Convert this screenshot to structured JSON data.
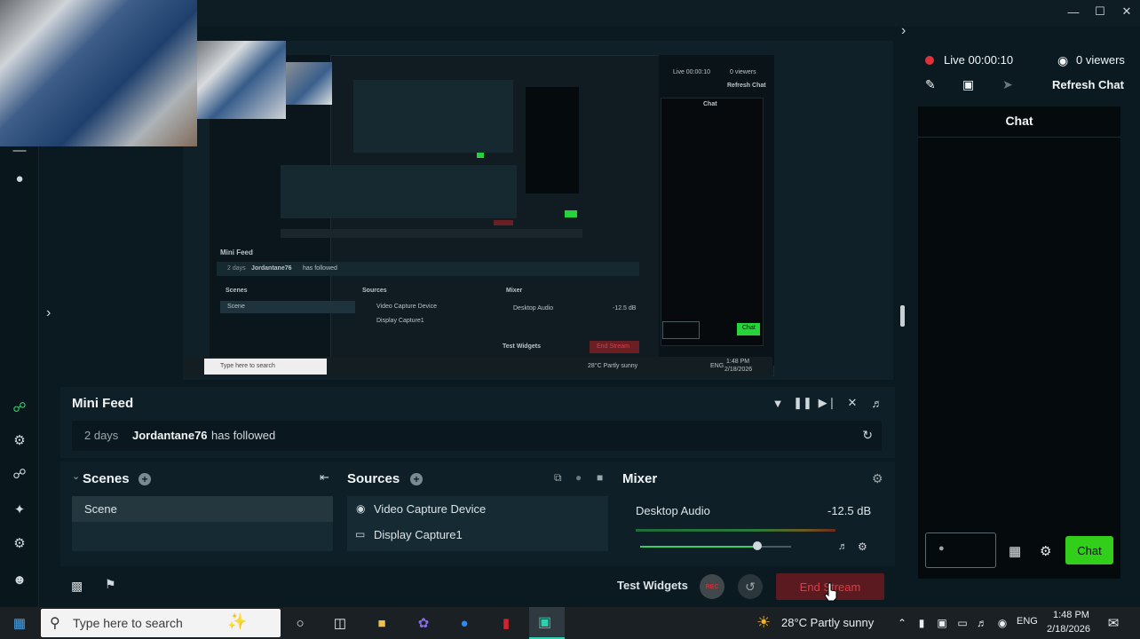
{
  "window": {
    "minimize_icon": "minimize-icon",
    "maximize_icon": "maximize-icon",
    "close_icon": "close-icon"
  },
  "mini_feed": {
    "title": "Mini Feed",
    "events": [
      {
        "time": "2 days",
        "user": "Jordantane76",
        "action": "has followed"
      }
    ]
  },
  "scenes": {
    "title": "Scenes",
    "items": [
      "Scene"
    ]
  },
  "sources": {
    "title": "Sources",
    "items": [
      "Video Capture Device",
      "Display Capture1"
    ]
  },
  "mixer": {
    "title": "Mixer",
    "channels": [
      {
        "name": "Desktop Audio",
        "level": "-12.5 dB",
        "volume_fraction": 0.78
      }
    ]
  },
  "controls": {
    "test_widgets": "Test Widgets",
    "rec_label": "REC",
    "end_stream": "End Stream"
  },
  "stream_status": {
    "live": "Live 00:00:10",
    "viewers": "0 viewers",
    "refresh_chat": "Refresh Chat"
  },
  "chat": {
    "title": "Chat",
    "send_label": "Chat"
  },
  "nested_preview": {
    "live": "Live 00:00:10",
    "viewers": "0 viewers",
    "refresh_chat": "Refresh Chat",
    "chat_title": "Chat",
    "mini_feed_title": "Mini Feed",
    "feed_time": "2 days",
    "feed_user": "Jordantane76",
    "feed_action": "has followed",
    "scenes": "Scenes",
    "scene_item": "Scene",
    "sources": "Sources",
    "source_1": "Video Capture Device",
    "source_2": "Display Capture1",
    "mixer": "Mixer",
    "desktop_audio": "Desktop Audio",
    "audio_level": "-12.5 dB",
    "test_widgets": "Test Widgets",
    "end_stream": "End Stream",
    "chat_button": "Chat",
    "search_placeholder": "Type here to search",
    "weather": "28°C  Partly sunny",
    "lang": "ENG",
    "time": "1:48 PM",
    "date": "2/18/2026"
  },
  "taskbar": {
    "search_placeholder": "Type here to search",
    "weather": "28°C  Partly sunny",
    "language": "ENG",
    "time": "1:48 PM",
    "date": "2/18/2026"
  }
}
